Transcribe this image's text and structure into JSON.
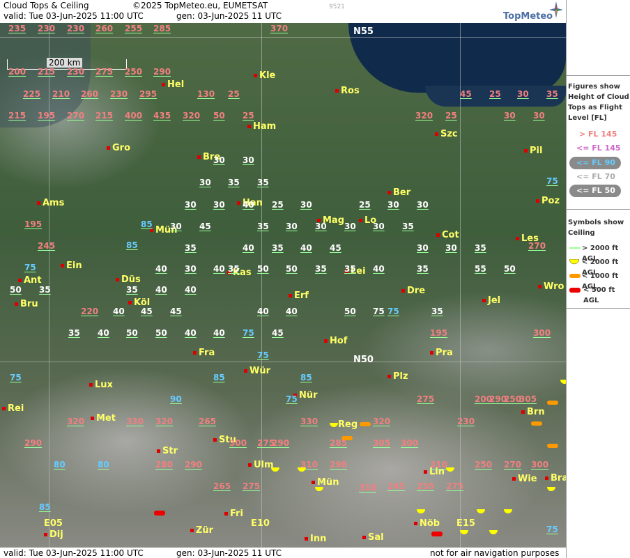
{
  "header": {
    "title": "Cloud Tops & Ceiling",
    "copyright": "©2025 TopMeteo.eu, EUMETSAT",
    "valid": "valid:  Tue  03-Jun-2025  11:00 UTC",
    "gen": "gen: 03-Jun-2025 11 UTC",
    "code": "9521",
    "logo": "TopMeteo"
  },
  "footer": {
    "valid": "valid:  Tue  03-Jun-2025  11:00 UTC",
    "gen": "gen: 03-Jun-2025 11 UTC",
    "note": "not for air navigation purposes"
  },
  "map": {
    "scale_label": "200 km",
    "grid_labels": {
      "n55": "N55",
      "n50": "N50",
      "e05": "E05",
      "e10": "E10",
      "e15": "E15"
    },
    "cities": [
      {
        "name": "Kle"
      },
      {
        "name": "Hel"
      },
      {
        "name": "Ros"
      },
      {
        "name": "Ham"
      },
      {
        "name": "Szc"
      },
      {
        "name": "Gro"
      },
      {
        "name": "Bre"
      },
      {
        "name": "Pil"
      },
      {
        "name": "Ber"
      },
      {
        "name": "Ams"
      },
      {
        "name": "Han"
      },
      {
        "name": "Poz"
      },
      {
        "name": "Mag"
      },
      {
        "name": "Lo"
      },
      {
        "name": "Mün"
      },
      {
        "name": "Cot"
      },
      {
        "name": "Les"
      },
      {
        "name": "Ein"
      },
      {
        "name": "Kas"
      },
      {
        "name": "Lei"
      },
      {
        "name": "Ant"
      },
      {
        "name": "Düs"
      },
      {
        "name": "Dre"
      },
      {
        "name": "Wro"
      },
      {
        "name": "Bru"
      },
      {
        "name": "Köl"
      },
      {
        "name": "Erf"
      },
      {
        "name": "Jel"
      },
      {
        "name": "Hof"
      },
      {
        "name": "Fra"
      },
      {
        "name": "Pra"
      },
      {
        "name": "Lux"
      },
      {
        "name": "Wür"
      },
      {
        "name": "Plz"
      },
      {
        "name": "Nür"
      },
      {
        "name": "Rei"
      },
      {
        "name": "Met"
      },
      {
        "name": "Reg"
      },
      {
        "name": "Brn"
      },
      {
        "name": "Stu"
      },
      {
        "name": "Str"
      },
      {
        "name": "Ulm"
      },
      {
        "name": "Lin"
      },
      {
        "name": "Wie"
      },
      {
        "name": "Bra"
      },
      {
        "name": "Mün"
      },
      {
        "name": "Fri"
      },
      {
        "name": "Dij"
      },
      {
        "name": "Zür"
      },
      {
        "name": "Inn"
      },
      {
        "name": "Sal"
      },
      {
        "name": "Nöb"
      }
    ],
    "values_row1": [
      "235",
      "230",
      "230",
      "260",
      "255",
      "285",
      "370"
    ],
    "values_row2": [
      "200",
      "215",
      "230",
      "275",
      "250",
      "290"
    ],
    "values_row3": [
      "225",
      "210",
      "260",
      "230",
      "295",
      "130",
      "25",
      "45",
      "25",
      "30",
      "35"
    ],
    "values_row4": [
      "215",
      "195",
      "270",
      "215",
      "400",
      "435",
      "320",
      "50",
      "25",
      "320",
      "25",
      "30",
      "30"
    ],
    "values_white": [
      "30",
      "30",
      "30",
      "35",
      "35",
      "30",
      "30",
      "40",
      "25",
      "30",
      "25",
      "30",
      "30",
      "30",
      "45",
      "35",
      "30",
      "30",
      "30",
      "30",
      "35",
      "35",
      "40",
      "35",
      "40",
      "45",
      "30",
      "30",
      "35",
      "40",
      "30",
      "40",
      "35",
      "50",
      "50",
      "35",
      "35",
      "40",
      "35",
      "55",
      "50",
      "50",
      "35",
      "35",
      "40",
      "40",
      "40",
      "45",
      "45",
      "40",
      "40",
      "50",
      "75",
      "35",
      "35",
      "40",
      "50",
      "50",
      "40",
      "40",
      "45"
    ],
    "values_cyan": [
      "85",
      "85",
      "75",
      "75",
      "80",
      "75",
      "75",
      "85",
      "75",
      "90",
      "85",
      "75",
      "80",
      "75",
      "85",
      "75"
    ],
    "values_pink": [
      "195",
      "245",
      "270",
      "220",
      "300",
      "320",
      "195",
      "230",
      "275",
      "290",
      "305",
      "200",
      "250",
      "290",
      "320",
      "330",
      "265",
      "300",
      "275",
      "330",
      "285",
      "320",
      "300",
      "310",
      "280",
      "290",
      "265",
      "275",
      "290",
      "310",
      "290",
      "305",
      "245",
      "255",
      "275",
      "250",
      "270",
      "300",
      "310"
    ]
  },
  "legend": {
    "figures_title": "Figures show Height of Cloud Tops as Flight Level  [FL]",
    "fl": [
      {
        "label": "> FL 145",
        "color": "#f08080"
      },
      {
        "label": "<= FL 145",
        "color": "#cc66cc"
      },
      {
        "label": "<= FL 90",
        "color": "#66ccff"
      },
      {
        "label": "<= FL 70",
        "color": "#aaaaaa"
      },
      {
        "label": "<= FL 50",
        "color": "#ffffff"
      }
    ],
    "symbols_title": "Symbols show Ceiling",
    "symbols": [
      {
        "label": "> 2000 ft AGL",
        "color": "#99ff99"
      },
      {
        "label": "< 2000 ft AGL",
        "color": "#ffff00"
      },
      {
        "label": "< 1000 ft AGL",
        "color": "#ff9900"
      },
      {
        "label": "< 500 ft AGL",
        "color": "#ff0000"
      }
    ]
  }
}
